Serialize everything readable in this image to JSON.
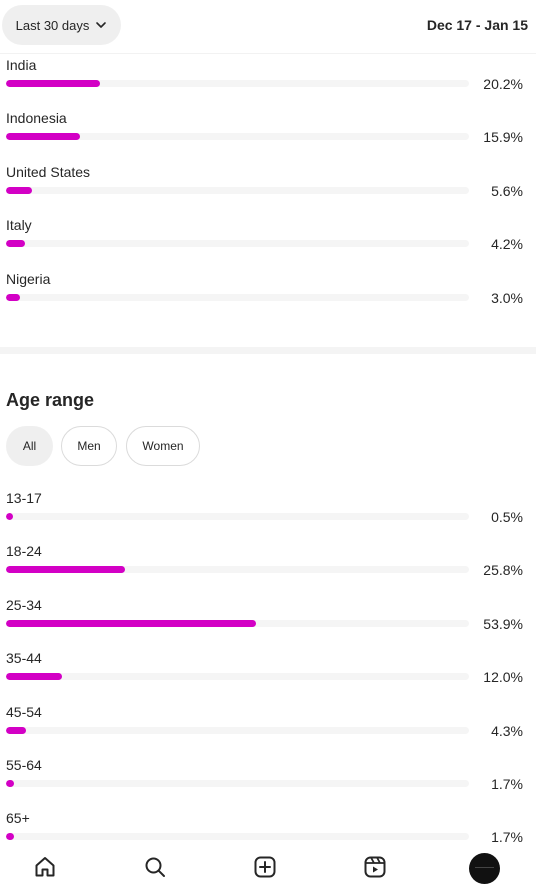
{
  "header": {
    "range_label": "Last 30 days",
    "date_range": "Dec 17 - Jan 15"
  },
  "countries": [
    {
      "label": "India",
      "value": "20.2%",
      "pct": 20.2
    },
    {
      "label": "Indonesia",
      "value": "15.9%",
      "pct": 15.9
    },
    {
      "label": "United States",
      "value": "5.6%",
      "pct": 5.6
    },
    {
      "label": "Italy",
      "value": "4.2%",
      "pct": 4.2
    },
    {
      "label": "Nigeria",
      "value": "3.0%",
      "pct": 3.0
    }
  ],
  "age": {
    "title": "Age range",
    "filters": [
      "All",
      "Men",
      "Women"
    ],
    "selected_filter": "All",
    "rows": [
      {
        "label": "13-17",
        "value": "0.5%",
        "pct": 0.5
      },
      {
        "label": "18-24",
        "value": "25.8%",
        "pct": 25.8
      },
      {
        "label": "25-34",
        "value": "53.9%",
        "pct": 53.9
      },
      {
        "label": "35-44",
        "value": "12.0%",
        "pct": 12.0
      },
      {
        "label": "45-54",
        "value": "4.3%",
        "pct": 4.3
      },
      {
        "label": "55-64",
        "value": "1.7%",
        "pct": 1.7
      },
      {
        "label": "65+",
        "value": "1.7%",
        "pct": 1.7
      }
    ]
  },
  "nav": {
    "items": [
      "home-icon",
      "search-icon",
      "create-icon",
      "reels-icon",
      "profile-avatar"
    ]
  },
  "colors": {
    "bar_fill": "#d300c5",
    "bar_track": "#f5f5f5"
  }
}
